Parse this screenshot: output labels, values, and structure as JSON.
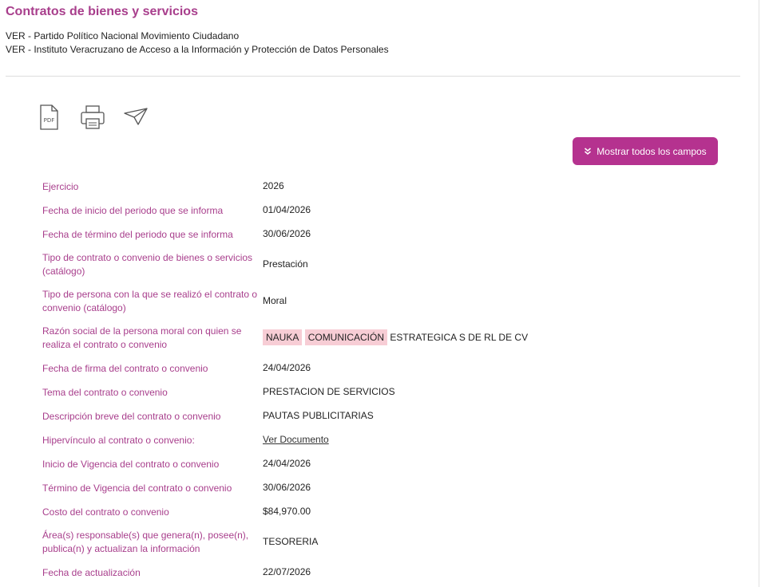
{
  "header": {
    "title": "Contratos de bienes y servicios",
    "subline1": "VER - Partido Político Nacional Movimiento Ciudadano",
    "subline2": "VER - Instituto Veracruzano de Acceso a la Información y Protección de Datos Personales"
  },
  "toolbar": {
    "pdf_icon_text": "PDF",
    "icons": [
      "pdf-icon",
      "print-icon",
      "send-icon"
    ],
    "show_all_label": "Mostrar todos los campos"
  },
  "fields": {
    "ejercicio": {
      "label": "Ejercicio",
      "value": "2026"
    },
    "fecha_inicio": {
      "label": "Fecha de inicio del periodo que se informa",
      "value": "01/04/2026"
    },
    "fecha_termino": {
      "label": "Fecha de término del periodo que se informa",
      "value": "30/06/2026"
    },
    "tipo_contrato": {
      "label": "Tipo de contrato o convenio de bienes o servicios (catálogo)",
      "value": "Prestación"
    },
    "tipo_persona": {
      "label": "Tipo de persona con la que se realizó el contrato o convenio (catálogo)",
      "value": "Moral"
    },
    "razon_social": {
      "label": "Razón social de la persona moral con quien se realiza el contrato o convenio",
      "part1": "NAUKA",
      "part2": "COMUNICACIÓN",
      "part3": "ESTRATEGICA S DE RL DE CV"
    },
    "fecha_firma": {
      "label": "Fecha de firma del contrato o convenio",
      "value": "24/04/2026"
    },
    "tema": {
      "label": "Tema del contrato o convenio",
      "value": "PRESTACION DE SERVICIOS"
    },
    "descripcion": {
      "label": "Descripción breve del contrato o convenio",
      "value": "PAUTAS PUBLICITARIAS"
    },
    "hipervinculo": {
      "label": "Hipervínculo al contrato o convenio:",
      "value": "Ver Documento"
    },
    "inicio_vigencia": {
      "label": "Inicio de Vigencia del contrato o convenio",
      "value": "24/04/2026"
    },
    "termino_vigencia": {
      "label": "Término de Vigencia del contrato o convenio",
      "value": "30/06/2026"
    },
    "costo": {
      "label": "Costo del contrato o convenio",
      "value": "$84,970.00"
    },
    "area": {
      "label": "Área(s) responsable(s) que genera(n), posee(n), publica(n) y actualizan la información",
      "value": "TESORERIA"
    },
    "fecha_actualizacion": {
      "label": "Fecha de actualización",
      "value": "22/07/2026"
    }
  }
}
